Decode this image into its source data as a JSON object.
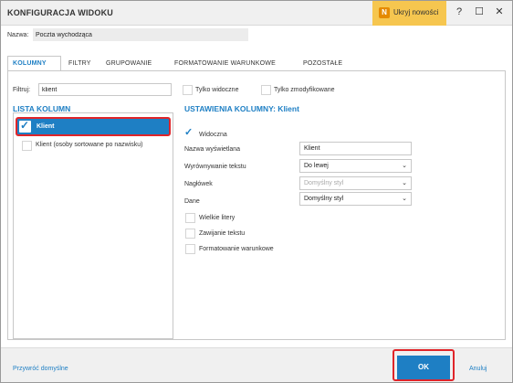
{
  "window": {
    "title": "KONFIGURACJA WIDOKU",
    "hide_news_badge": "N",
    "hide_news_label": "Ukryj nowości",
    "help_icon": "?",
    "maximize_icon": "☐",
    "close_icon": "✕"
  },
  "name_row": {
    "label": "Nazwa:",
    "value": "Poczta wychodząca"
  },
  "tabs": [
    {
      "label": "KOLUMNY",
      "active": true
    },
    {
      "label": "FILTRY",
      "active": false
    },
    {
      "label": "GRUPOWANIE",
      "active": false
    },
    {
      "label": "FORMATOWANIE WARUNKOWE",
      "active": false
    },
    {
      "label": "POZOSTAŁE",
      "active": false
    }
  ],
  "filter": {
    "label": "Filtruj:",
    "value": "klient",
    "only_visible_label": "Tylko widoczne",
    "only_modified_label": "Tylko zmodyfikowane"
  },
  "column_list": {
    "title": "LISTA KOLUMN",
    "items": [
      {
        "label": "Klient",
        "checked": true,
        "selected": true
      },
      {
        "label": "Klient (osoby sortowane po nazwisku)",
        "checked": false,
        "selected": false
      }
    ]
  },
  "column_settings": {
    "title": "USTAWIENIA KOLUMNY: Klient",
    "visible_label": "Widoczna",
    "display_name_label": "Nazwa wyświetlana",
    "display_name_value": "Klient",
    "text_align_label": "Wyrównywanie tekstu",
    "text_align_value": "Do lewej",
    "header_label": "Nagłówek",
    "header_value": "Domyślny styl",
    "data_label": "Dane",
    "data_value": "Domyślny styl",
    "uppercase_label": "Wielkie litery",
    "wrap_label": "Zawijanie tekstu",
    "conditional_format_label": "Formatowanie warunkowe"
  },
  "footer": {
    "restore_label": "Przywróć domyślne",
    "ok_label": "OK",
    "cancel_label": "Anuluj"
  },
  "colors": {
    "accent": "#1e7fc4",
    "highlight_outline": "#e0252a",
    "hide_news_bg": "#f6c64f"
  }
}
